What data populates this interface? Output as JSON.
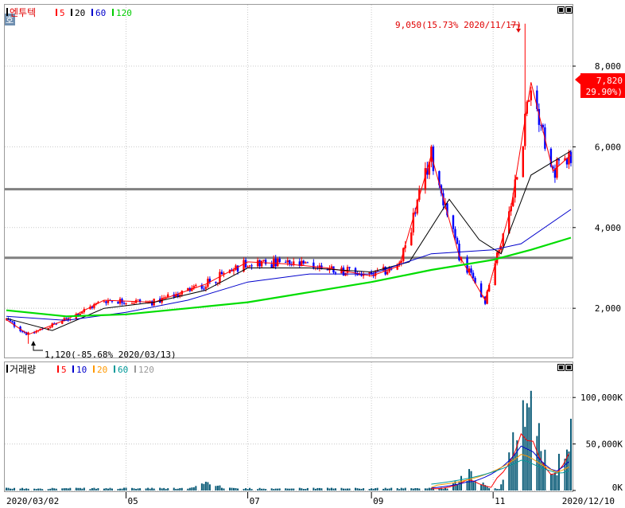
{
  "price_panel": {
    "badge": "호",
    "name": "엔투텍",
    "legend": [
      {
        "label": "5",
        "color": "#ff0000"
      },
      {
        "label": "20",
        "color": "#000000"
      },
      {
        "label": "60",
        "color": "#0000cc"
      },
      {
        "label": "120",
        "color": "#00cc00"
      }
    ],
    "high_annotation": "9,050(15.73% 2020/11/17)",
    "low_annotation": "1,120(-85.68% 2020/03/13)",
    "current_price": "7,820",
    "current_change": "( 29.90%)"
  },
  "volume_panel": {
    "name": "거래량",
    "legend": [
      {
        "label": "5",
        "color": "#ff0000"
      },
      {
        "label": "10",
        "color": "#0000cc"
      },
      {
        "label": "20",
        "color": "#ff9900"
      },
      {
        "label": "60",
        "color": "#009999"
      },
      {
        "label": "120",
        "color": "#999999"
      }
    ]
  },
  "colors": {
    "up": "#ff0000",
    "down": "#0000ff",
    "ma5": "#ff0000",
    "ma20": "#000000",
    "ma60": "#0000cc",
    "ma120": "#00dd00",
    "hline": "#808080"
  },
  "chart_data": [
    {
      "type": "candlestick",
      "title": "엔투텍",
      "date_range": [
        "2020/03/02",
        "2020/12/10"
      ],
      "x_tick_labels": [
        "2020/03/02",
        "05",
        "07",
        "09",
        "11",
        "2020/12/10"
      ],
      "y_tick_labels": [
        "2,000",
        "4,000",
        "6,000",
        "8,000"
      ],
      "ylim": [
        800,
        9500
      ],
      "y_scale": "linear",
      "horizontal_lines": [
        4950,
        3250
      ],
      "series": [
        {
          "name": "5",
          "approx_points": [
            [
              "2020/03/02",
              1720
            ],
            [
              "2020/03/13",
              1350
            ],
            [
              "2020/04/01",
              1720
            ],
            [
              "2020/04/20",
              2200
            ],
            [
              "2020/05/15",
              2150
            ],
            [
              "2020/06/10",
              2600
            ],
            [
              "2020/07/01",
              3150
            ],
            [
              "2020/07/20",
              3100
            ],
            [
              "2020/08/10",
              3000
            ],
            [
              "2020/09/01",
              2800
            ],
            [
              "2020/09/15",
              3050
            ],
            [
              "2020/10/01",
              5800
            ],
            [
              "2020/10/15",
              3300
            ],
            [
              "2020/10/28",
              2200
            ],
            [
              "2020/11/10",
              4500
            ],
            [
              "2020/11/20",
              7600
            ],
            [
              "2020/12/01",
              5400
            ],
            [
              "2020/12/10",
              5800
            ]
          ]
        },
        {
          "name": "20",
          "approx_points": [
            [
              "2020/03/02",
              1750
            ],
            [
              "2020/03/25",
              1450
            ],
            [
              "2020/04/20",
              2000
            ],
            [
              "2020/05/15",
              2150
            ],
            [
              "2020/06/10",
              2450
            ],
            [
              "2020/07/01",
              3000
            ],
            [
              "2020/08/01",
              3000
            ],
            [
              "2020/09/01",
              2900
            ],
            [
              "2020/09/20",
              3150
            ],
            [
              "2020/10/10",
              4700
            ],
            [
              "2020/10/25",
              3700
            ],
            [
              "2020/11/05",
              3350
            ],
            [
              "2020/11/20",
              5300
            ],
            [
              "2020/12/10",
              5900
            ]
          ]
        },
        {
          "name": "60",
          "approx_points": [
            [
              "2020/03/02",
              1800
            ],
            [
              "2020/04/01",
              1700
            ],
            [
              "2020/05/01",
              1900
            ],
            [
              "2020/06/01",
              2200
            ],
            [
              "2020/07/01",
              2650
            ],
            [
              "2020/08/01",
              2850
            ],
            [
              "2020/09/01",
              2850
            ],
            [
              "2020/10/01",
              3350
            ],
            [
              "2020/11/01",
              3450
            ],
            [
              "2020/11/15",
              3600
            ],
            [
              "2020/12/10",
              4450
            ]
          ]
        },
        {
          "name": "120",
          "approx_points": [
            [
              "2020/03/02",
              1950
            ],
            [
              "2020/04/01",
              1800
            ],
            [
              "2020/05/01",
              1850
            ],
            [
              "2020/06/01",
              2000
            ],
            [
              "2020/07/01",
              2150
            ],
            [
              "2020/08/01",
              2400
            ],
            [
              "2020/09/01",
              2650
            ],
            [
              "2020/10/01",
              2950
            ],
            [
              "2020/11/01",
              3200
            ],
            [
              "2020/11/20",
              3450
            ],
            [
              "2020/12/10",
              3750
            ]
          ]
        }
      ],
      "annotations": [
        {
          "text": "9,050(15.73% 2020/11/17)",
          "date": "2020/11/17",
          "value": 9050
        },
        {
          "text": "1,120(-85.68% 2020/03/13)",
          "date": "2020/03/13",
          "value": 1120
        },
        {
          "text": "7,820",
          "value": 7820
        },
        {
          "text": "( 29.90%)"
        }
      ]
    },
    {
      "type": "bar",
      "title": "거래량",
      "y_tick_labels": [
        "0K",
        "50,000K",
        "100,000K"
      ],
      "ylim": [
        0,
        125000
      ],
      "unit": "K",
      "series_names": [
        "5",
        "10",
        "20",
        "60",
        "120"
      ],
      "approx_volume_peaks_K": [
        [
          "2020/06/10",
          12000
        ],
        [
          "2020/10/20",
          22000
        ],
        [
          "2020/11/16",
          115000
        ],
        [
          "2020/11/20",
          100000
        ],
        [
          "2020/12/10",
          75000
        ]
      ]
    }
  ]
}
